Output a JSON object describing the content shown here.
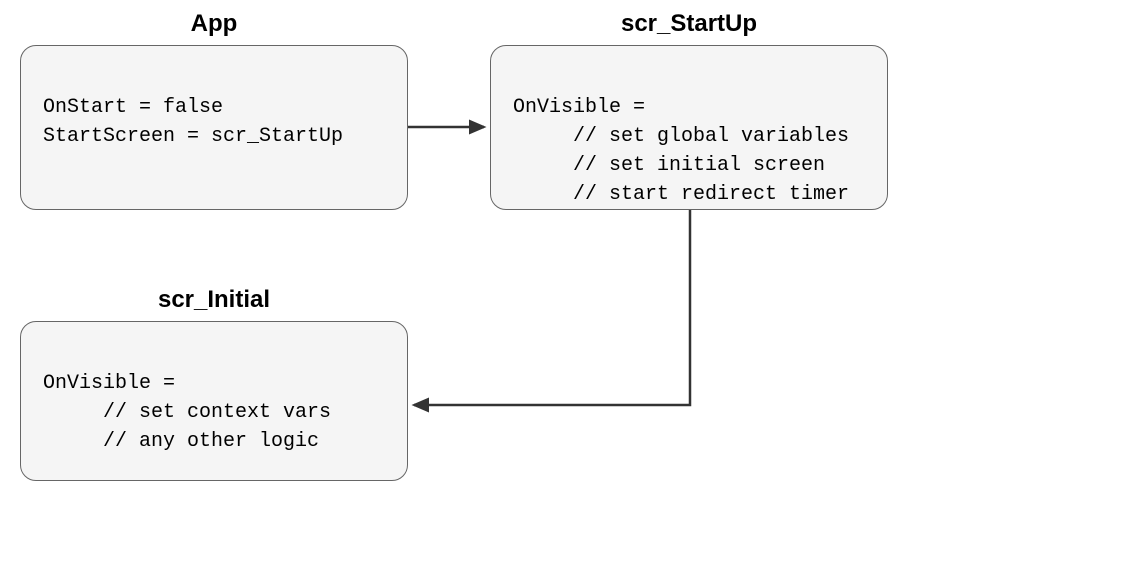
{
  "nodes": {
    "app": {
      "title": "App",
      "lines": [
        "OnStart = false",
        "StartScreen = scr_StartUp"
      ]
    },
    "startup": {
      "title": "scr_StartUp",
      "lines": [
        "OnVisible =",
        "     // set global variables",
        "     // set initial screen",
        "     // start redirect timer"
      ]
    },
    "initial": {
      "title": "scr_Initial",
      "lines": [
        "OnVisible =",
        "     // set context vars",
        "     // any other logic"
      ]
    }
  }
}
